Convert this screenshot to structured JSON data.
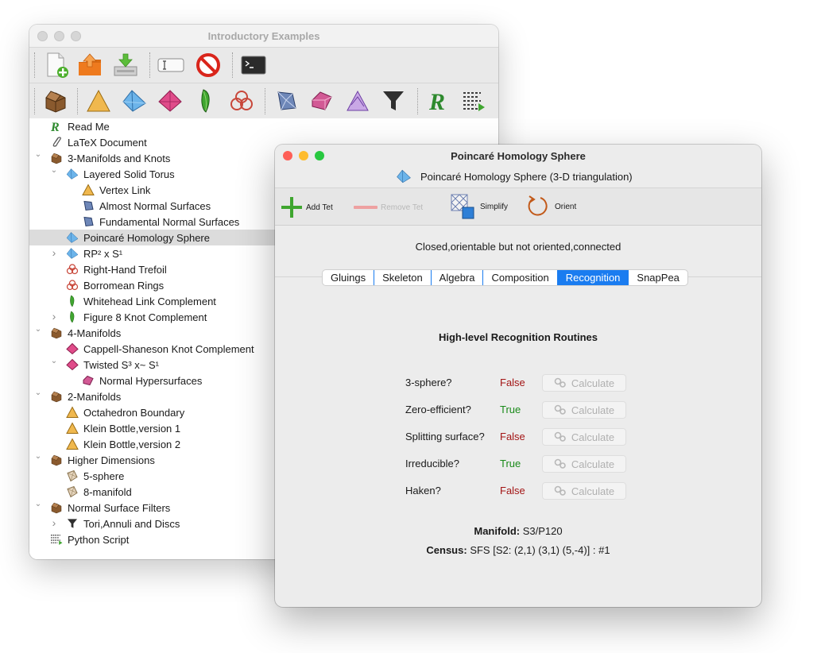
{
  "main_window": {
    "title": "Introductory Examples",
    "tree": [
      {
        "label": "Read Me",
        "icon": "readme-icon",
        "indent": 0,
        "chev": ""
      },
      {
        "label": "LaTeX Document",
        "icon": "latex-icon",
        "indent": 0,
        "chev": ""
      },
      {
        "label": "3-Manifolds and Knots",
        "icon": "container-icon",
        "indent": 0,
        "chev": "down"
      },
      {
        "label": "Layered Solid Torus",
        "icon": "tetrahedron-icon",
        "indent": 1,
        "chev": "down"
      },
      {
        "label": "Vertex Link",
        "icon": "triangle-icon",
        "indent": 2,
        "chev": ""
      },
      {
        "label": "Almost Normal Surfaces",
        "icon": "normal-surfaces-icon",
        "indent": 2,
        "chev": ""
      },
      {
        "label": "Fundamental Normal Surfaces",
        "icon": "normal-surfaces-icon",
        "indent": 2,
        "chev": ""
      },
      {
        "label": "Poincaré Homology Sphere",
        "icon": "tetrahedron-icon",
        "indent": 1,
        "chev": "",
        "selected": true
      },
      {
        "label": "RP² x S¹",
        "icon": "tetrahedron-icon",
        "indent": 1,
        "chev": "right"
      },
      {
        "label": "Right-Hand Trefoil",
        "icon": "knot-icon",
        "indent": 1,
        "chev": ""
      },
      {
        "label": "Borromean Rings",
        "icon": "knot-icon",
        "indent": 1,
        "chev": ""
      },
      {
        "label": "Whitehead Link Complement",
        "icon": "snappea-icon",
        "indent": 1,
        "chev": ""
      },
      {
        "label": "Figure 8 Knot Complement",
        "icon": "snappea-icon",
        "indent": 1,
        "chev": "right"
      },
      {
        "label": "4-Manifolds",
        "icon": "container-icon",
        "indent": 0,
        "chev": "down"
      },
      {
        "label": "Cappell-Shaneson Knot Complement",
        "icon": "pentachoron-icon",
        "indent": 1,
        "chev": ""
      },
      {
        "label": "Twisted S³ x~ S¹",
        "icon": "pentachoron-icon",
        "indent": 1,
        "chev": "down"
      },
      {
        "label": "Normal Hypersurfaces",
        "icon": "hypersurfaces-icon",
        "indent": 2,
        "chev": ""
      },
      {
        "label": "2-Manifolds",
        "icon": "container-icon",
        "indent": 0,
        "chev": "down"
      },
      {
        "label": "Octahedron Boundary",
        "icon": "triangle-icon",
        "indent": 1,
        "chev": ""
      },
      {
        "label": "Klein Bottle,version 1",
        "icon": "triangle-icon",
        "indent": 1,
        "chev": ""
      },
      {
        "label": "Klein Bottle,version 2",
        "icon": "triangle-icon",
        "indent": 1,
        "chev": ""
      },
      {
        "label": "Higher Dimensions",
        "icon": "container-icon",
        "indent": 0,
        "chev": "down"
      },
      {
        "label": "5-sphere",
        "icon": "generic-triangulation-icon",
        "indent": 1,
        "chev": ""
      },
      {
        "label": "8-manifold",
        "icon": "generic-triangulation-icon",
        "indent": 1,
        "chev": ""
      },
      {
        "label": "Normal Surface Filters",
        "icon": "container-icon",
        "indent": 0,
        "chev": "down"
      },
      {
        "label": "Tori,Annuli and Discs",
        "icon": "filter-icon",
        "indent": 1,
        "chev": "right"
      },
      {
        "label": "Python Script",
        "icon": "script-icon",
        "indent": 0,
        "chev": ""
      }
    ]
  },
  "dialog": {
    "title": "Poincaré Homology Sphere",
    "subtitle": "Poincaré Homology Sphere (3-D triangulation)",
    "toolbar": {
      "add_tet": "Add Tet",
      "remove_tet": "Remove Tet",
      "simplify": "Simplify",
      "orient": "Orient"
    },
    "status": "Closed,orientable but not oriented,connected",
    "tabs": [
      "Gluings",
      "Skeleton",
      "Algebra",
      "Composition",
      "Recognition",
      "SnapPea"
    ],
    "active_tab": "Recognition",
    "recognition": {
      "heading": "High-level Recognition Routines",
      "rows": [
        {
          "label": "3-sphere?",
          "value": "False",
          "button": "Calculate"
        },
        {
          "label": "Zero-efficient?",
          "value": "True",
          "button": "Calculate"
        },
        {
          "label": "Splitting surface?",
          "value": "False",
          "button": "Calculate"
        },
        {
          "label": "Irreducible?",
          "value": "True",
          "button": "Calculate"
        },
        {
          "label": "Haken?",
          "value": "False",
          "button": "Calculate"
        }
      ],
      "manifold_label": "Manifold:",
      "manifold_value": "S3/P120",
      "census_label": "Census:",
      "census_value": "SFS [S2: (2,1) (3,1) (5,-4)] : #1"
    }
  },
  "colors": {
    "accent": "#1a7cf0",
    "false_color": "#a31515",
    "true_color": "#1a8a1a"
  }
}
